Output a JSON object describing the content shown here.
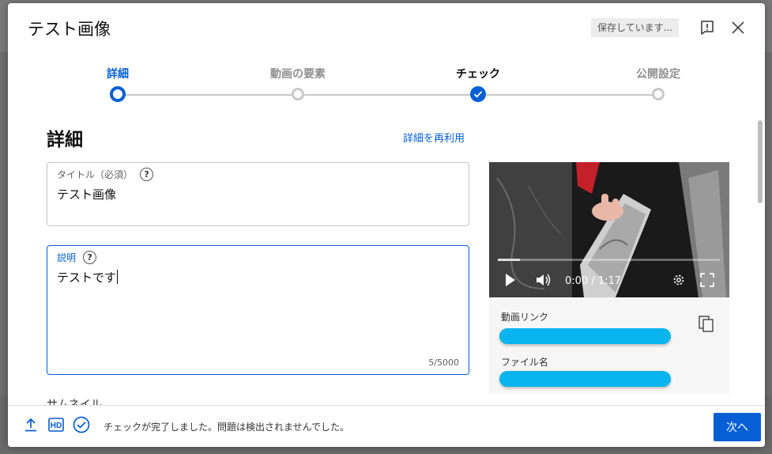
{
  "dialog": {
    "title": "テスト画像",
    "saving_status": "保存しています..."
  },
  "stepper": {
    "steps": [
      {
        "label": "詳細",
        "state": "current"
      },
      {
        "label": "動画の要素",
        "state": "pending"
      },
      {
        "label": "チェック",
        "state": "done"
      },
      {
        "label": "公開設定",
        "state": "pending"
      }
    ]
  },
  "details": {
    "heading": "詳細",
    "reuse_link": "詳細を再利用",
    "title_field": {
      "label": "タイトル（必須）",
      "value": "テスト画像"
    },
    "description_field": {
      "label": "説明",
      "value": "テストです",
      "counter": "5/5000"
    },
    "thumbnail_label": "サムネイル"
  },
  "video": {
    "time": "0:00 / 1:17",
    "progress": 0.1,
    "link_label": "動画リンク",
    "filename_label": "ファイル名"
  },
  "footer": {
    "status": "チェックが完了しました。問題は検出されませんでした。",
    "next_label": "次へ",
    "hd_label": "HD"
  },
  "colors": {
    "accent": "#065fd4",
    "redaction": "#0ab4ee"
  }
}
